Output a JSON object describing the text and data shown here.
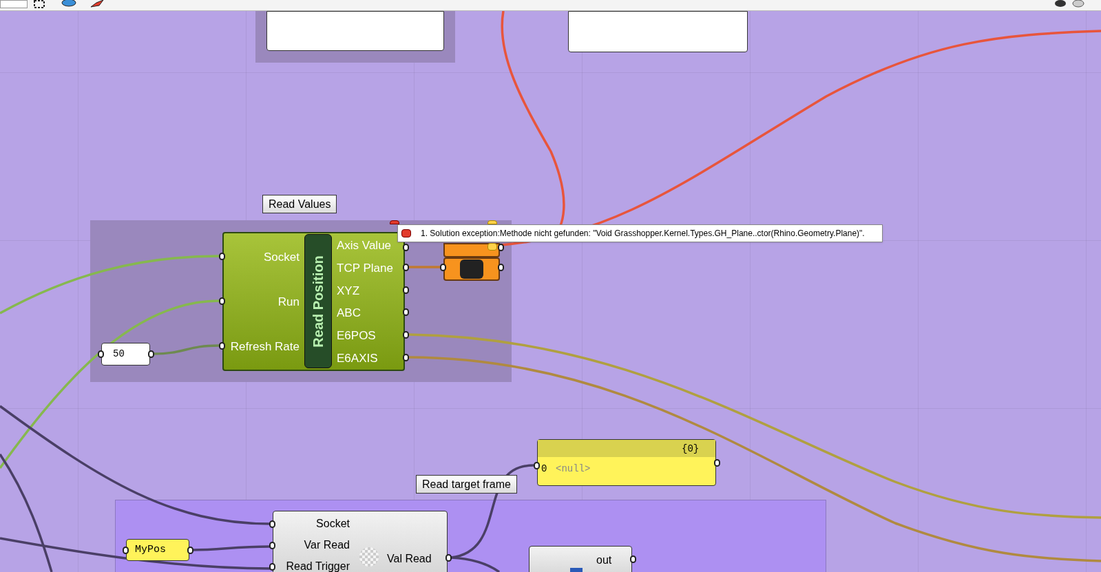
{
  "groups": [
    {
      "label": "Read Values"
    },
    {
      "label": "Read target frame"
    }
  ],
  "read_position": {
    "title": "Read Position",
    "inputs": [
      "Socket",
      "Run",
      "Refresh Rate"
    ],
    "outputs": [
      "Axis Value",
      "TCP Plane",
      "XYZ",
      "ABC",
      "E6POS",
      "E6AXIS"
    ]
  },
  "number_panel": {
    "value": "50"
  },
  "error_tooltip": {
    "text": "1. Solution exception:Methode nicht gefunden: \"Void Grasshopper.Kernel.Types.GH_Plane..ctor(Rhino.Geometry.Plane)\"."
  },
  "data_panel": {
    "path": "{0}",
    "rows": [
      {
        "index": "0",
        "value": "<null>"
      }
    ]
  },
  "var_panel": {
    "value": "MyPos"
  },
  "read_component": {
    "inputs": [
      "Socket",
      "Var Read",
      "Read Trigger"
    ],
    "outputs": [
      "Val Read"
    ]
  },
  "out_component": {
    "outputs": [
      "out"
    ]
  }
}
